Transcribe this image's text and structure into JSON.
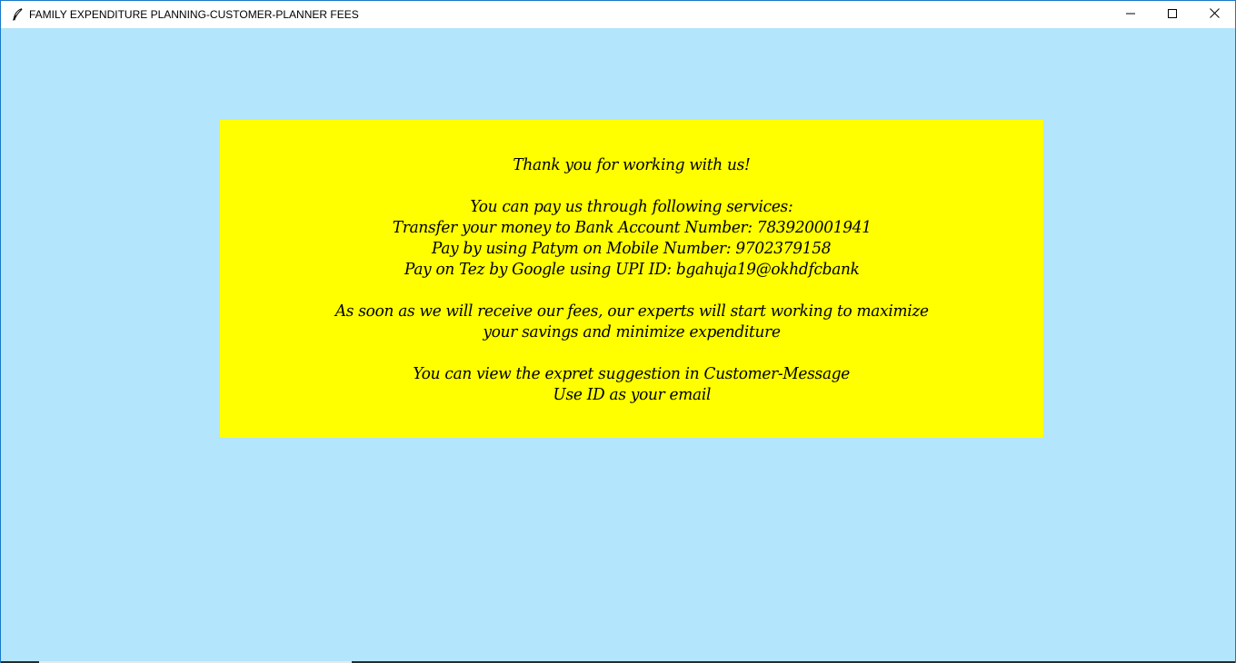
{
  "window": {
    "title": "FAMILY EXPENDITURE PLANNING-CUSTOMER-PLANNER FEES",
    "icon": "feather-icon",
    "controls": {
      "minimize_icon": "minimize-icon",
      "maximize_icon": "maximize-icon",
      "close_icon": "close-icon"
    }
  },
  "colors": {
    "background": "#b3e5fc",
    "message_box": "#ffff00",
    "text": "#000000"
  },
  "message": {
    "thanks": "Thank you for working with us!",
    "services_intro": "You can pay us through following services:",
    "bank": "Transfer your money to Bank Account Number: 783920001941",
    "paytm": "Pay by using Patym on Mobile Number: 9702379158",
    "tez": "Pay on Tez by Google using UPI ID: bgahuja19@okhdfcbank",
    "experts_line1": "As soon as we will receive our fees, our experts will start working to maximize",
    "experts_line2": "your savings and minimize expenditure",
    "view_suggestion": "You can view the expret suggestion in Customer-Message",
    "use_id": "Use ID as your email"
  }
}
